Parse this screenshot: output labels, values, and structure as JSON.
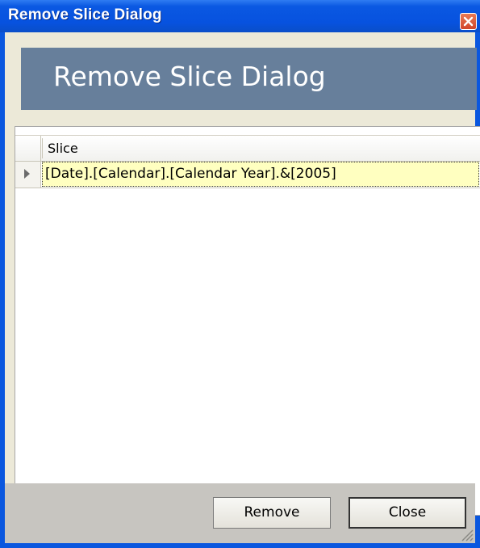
{
  "window": {
    "title": "Remove Slice Dialog",
    "close_icon": "close-icon",
    "accent": "#0a57df"
  },
  "banner": {
    "title": "Remove Slice Dialog",
    "color": "#677f9b"
  },
  "grid": {
    "columns": [
      "Slice"
    ],
    "rows": [
      {
        "slice": "[Date].[Calendar].[Calendar Year].&[2005]",
        "selected": true
      }
    ],
    "row_indicator_icon": "row-pointer-icon"
  },
  "footer": {
    "remove_label": "Remove",
    "close_label": "Close",
    "grip_icon": "resize-grip-icon"
  }
}
